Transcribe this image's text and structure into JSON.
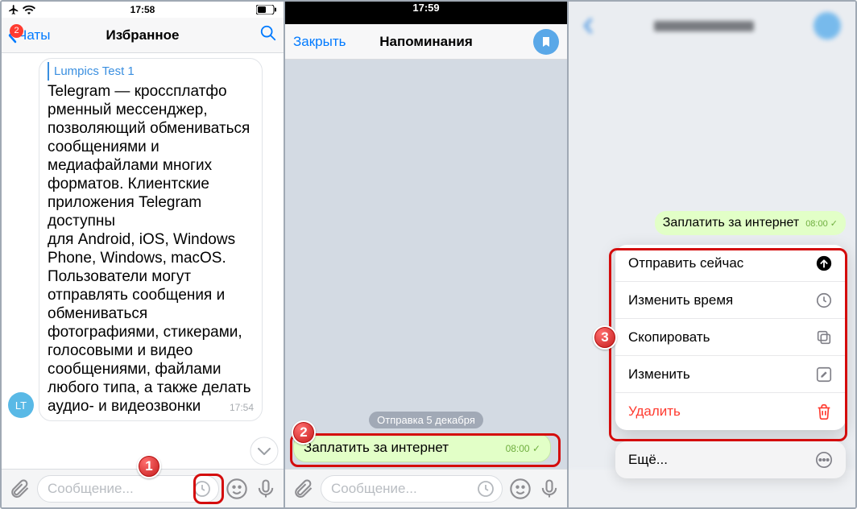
{
  "status": {
    "time1": "17:58",
    "time2": "17:59"
  },
  "pane1": {
    "back_label": "Чаты",
    "badge": "2",
    "title": "Избранное",
    "avatar": "LT",
    "quote_source": "Lumpics Test 1",
    "message_text": "Telegram — кроссплатфо\nрменный мессенджер, позволяющий обмениваться сообщениями и медиафайлами многих форматов. Клиентские приложения Telegram доступны\nдля Android, iOS, Windows Phone, Windows, macOS. Пользователи могут отправлять сообщения и обмениваться фотографиями, стикерами, голосовыми и видео сообщениями, файлами любого типа, а также делать аудио- и видеозвонки",
    "msg_time": "17:54",
    "composer_placeholder": "Сообщение..."
  },
  "pane2": {
    "close": "Закрыть",
    "title": "Напоминания",
    "send_label": "Отправка 5 декабря",
    "bubble_text": "Заплатить за интернет",
    "bubble_time": "08:00",
    "composer_placeholder": "Сообщение..."
  },
  "pane3": {
    "bubble_text": "Заплатить за интернет",
    "bubble_time": "08:00",
    "menu": {
      "send_now": "Отправить сейчас",
      "reschedule": "Изменить время",
      "copy": "Скопировать",
      "edit": "Изменить",
      "delete": "Удалить"
    },
    "more": "Ещё..."
  },
  "steps": {
    "s1": "1",
    "s2": "2",
    "s3": "3"
  }
}
